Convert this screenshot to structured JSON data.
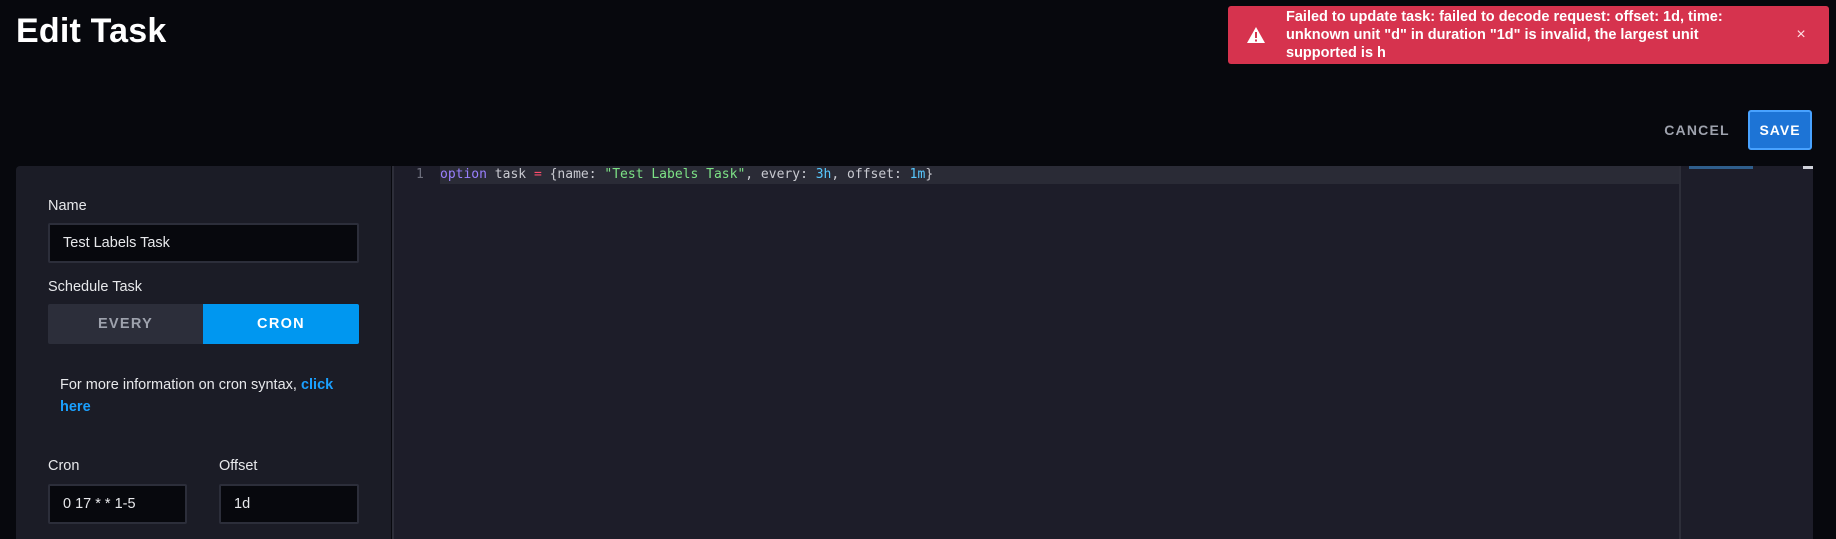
{
  "page": {
    "title": "Edit Task"
  },
  "toast": {
    "message": "Failed to update task: failed to decode request: offset: 1d, time: unknown unit \"d\" in duration \"1d\" is invalid, the largest unit supported is h",
    "close_glyph": "×",
    "color": "#d6334e"
  },
  "actions": {
    "cancel_label": "CANCEL",
    "save_label": "SAVE"
  },
  "form": {
    "name_label": "Name",
    "name_value": "Test Labels Task",
    "schedule_label": "Schedule Task",
    "schedule_options": [
      "EVERY",
      "CRON"
    ],
    "schedule_selected": "CRON",
    "info_text": "For more information on cron syntax, ",
    "info_link": "click here",
    "cron_label": "Cron",
    "cron_value": "0 17 * * 1-5",
    "offset_label": "Offset",
    "offset_value": "1d"
  },
  "editor": {
    "line_number": "1",
    "tokens": {
      "kw": "option",
      "t1": " task ",
      "op": "=",
      "t2": " {name: ",
      "str": "\"Test Labels Task\"",
      "t3": ", every: ",
      "num1": "3h",
      "t4": ", offset: ",
      "num2": "1m",
      "t5": "}"
    }
  },
  "colors": {
    "accent": "#0097f0",
    "save": "#1d74d6",
    "background": "#07080d",
    "panel": "#1b1c26"
  }
}
